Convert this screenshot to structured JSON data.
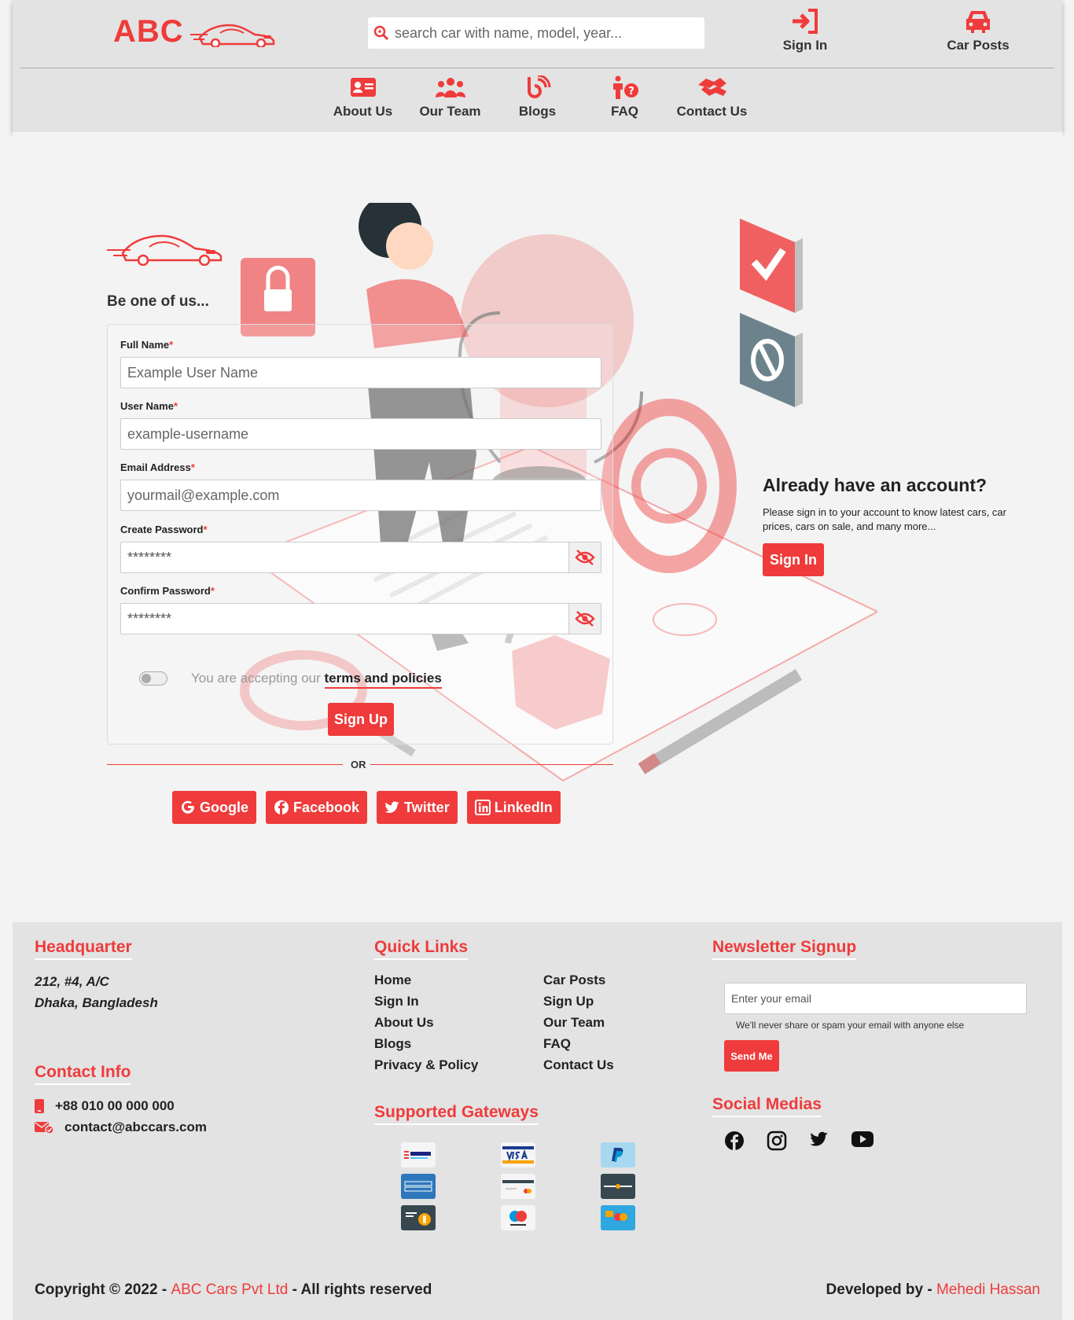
{
  "header": {
    "logo_text": "ABC",
    "search_placeholder": "search car with name, model, year...",
    "sign_in_label": "Sign In",
    "car_posts_label": "Car Posts",
    "nav": [
      {
        "label": "About Us",
        "icon": "id-card-icon"
      },
      {
        "label": "Our Team",
        "icon": "users-icon"
      },
      {
        "label": "Blogs",
        "icon": "blog-icon"
      },
      {
        "label": "FAQ",
        "icon": "person-question-icon"
      },
      {
        "label": "Contact Us",
        "icon": "handshake-icon"
      }
    ]
  },
  "form": {
    "title": "Be one of us...",
    "full_name_label": "Full Name",
    "full_name_placeholder": "Example User Name",
    "username_label": "User Name",
    "username_placeholder": "example-username",
    "email_label": "Email Address",
    "email_placeholder": "yourmail@example.com",
    "password_label": "Create Password",
    "password_value": "********",
    "confirm_label": "Confirm Password",
    "confirm_value": "********",
    "required_mark": "*",
    "terms_prefix": "You are accepting our",
    "terms_link": "terms and policies",
    "signup_label": "Sign Up",
    "or_text": "OR",
    "social_buttons": [
      "Google",
      "Facebook",
      "Twitter",
      "LinkedIn"
    ]
  },
  "have_account": {
    "title": "Already have an account?",
    "text": "Please sign in to your account to know latest cars, car prices, cars on sale, and many more...",
    "button": "Sign In"
  },
  "footer": {
    "headquarter_title": "Headquarter",
    "address_line1": "212, #4, A/C",
    "address_line2": "Dhaka, Bangladesh",
    "contact_title": "Contact Info",
    "phone": "+88 010 00 000 000",
    "email": "contact@abccars.com",
    "quick_links_title": "Quick Links",
    "quick_links_col1": [
      "Home",
      "Sign In",
      "About Us",
      "Blogs",
      "Privacy & Policy"
    ],
    "quick_links_col2": [
      "Car Posts",
      "Sign Up",
      "Our Team",
      "FAQ",
      "Contact Us"
    ],
    "gateways_title": "Supported Gateways",
    "gateways": [
      "bank-transfer",
      "visa",
      "paypal",
      "american-express",
      "credit-card",
      "discover",
      "bitcoin",
      "maestro",
      "mastercard"
    ],
    "newsletter_title": "Newsletter Signup",
    "newsletter_placeholder": "Enter your email",
    "newsletter_hint": "We'll never share or spam your email with anyone else",
    "send_label": "Send Me",
    "social_title": "Social Medias",
    "social_icons": [
      "facebook-icon",
      "instagram-icon",
      "twitter-icon",
      "youtube-icon"
    ],
    "copyright_prefix": "Copyright © 2022 -",
    "company": "ABC Cars Pvt Ltd",
    "copyright_suffix": "- All rights reserved",
    "developed_prefix": "Developed by -",
    "developer": "Mehedi Hassan"
  },
  "colors": {
    "accent": "#ef3b3b",
    "header_bg": "#e3e3e3",
    "page_bg": "#f3f3f3"
  }
}
